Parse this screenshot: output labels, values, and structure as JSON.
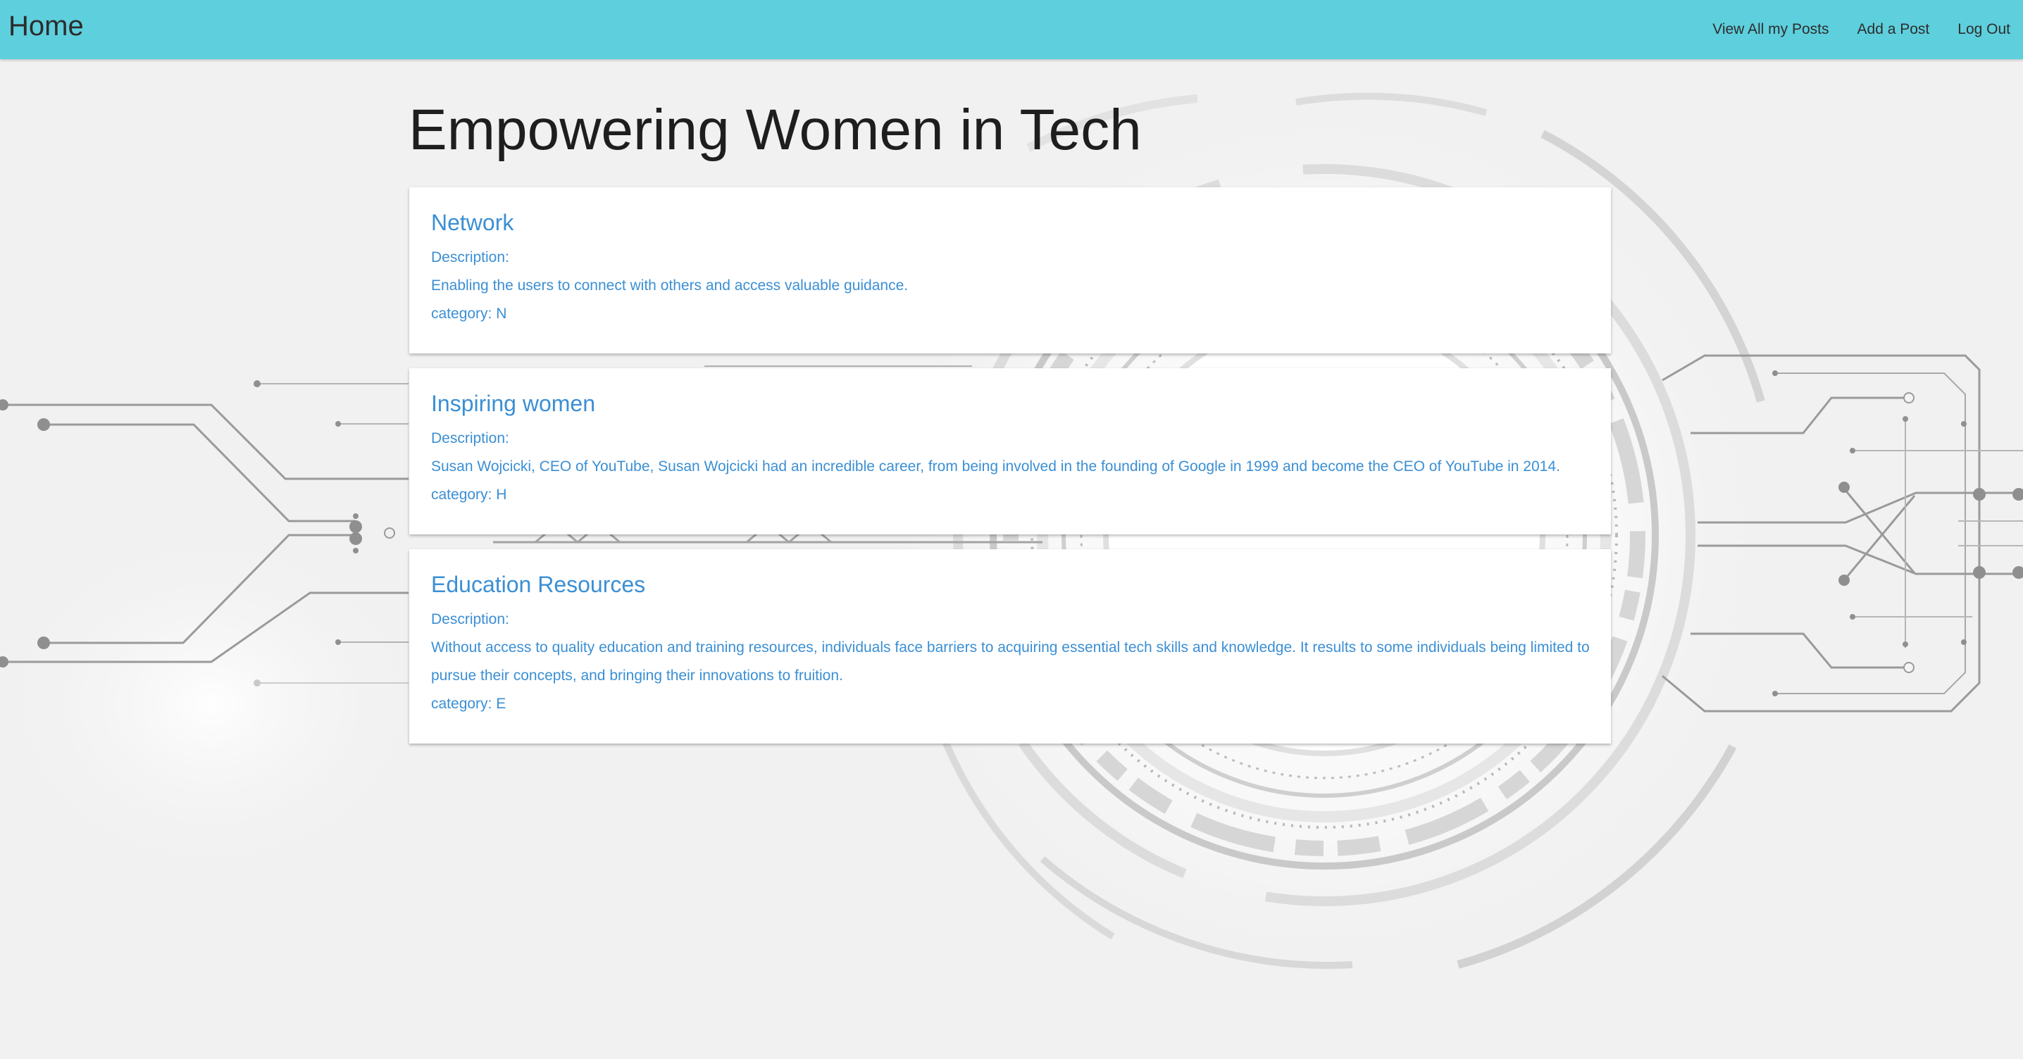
{
  "navbar": {
    "brand": "Home",
    "links": [
      {
        "label": "View All my Posts"
      },
      {
        "label": "Add a Post"
      },
      {
        "label": "Log Out"
      }
    ]
  },
  "page": {
    "title": "Empowering Women in Tech"
  },
  "posts": [
    {
      "title": "Network",
      "description_label": "Description:",
      "description": "Enabling the users to connect with others and access valuable guidance.",
      "category": "category: N"
    },
    {
      "title": "Inspiring women",
      "description_label": "Description:",
      "description": "Susan Wojcicki, CEO of YouTube, Susan Wojcicki had an incredible career, from being involved in the founding of Google in 1999 and become the CEO of YouTube in 2014.",
      "category": "category: H"
    },
    {
      "title": "Education Resources",
      "description_label": "Description:",
      "description": "Without access to quality education and training resources, individuals face barriers to acquiring essential tech skills and knowledge. It results to some individuals being limited to pursue their concepts, and bringing their innovations to fruition.",
      "category": "category: E"
    }
  ],
  "colors": {
    "navbar": "#5ecfdd",
    "link_text": "#3b8fd4",
    "background": "#f1f1f1"
  }
}
